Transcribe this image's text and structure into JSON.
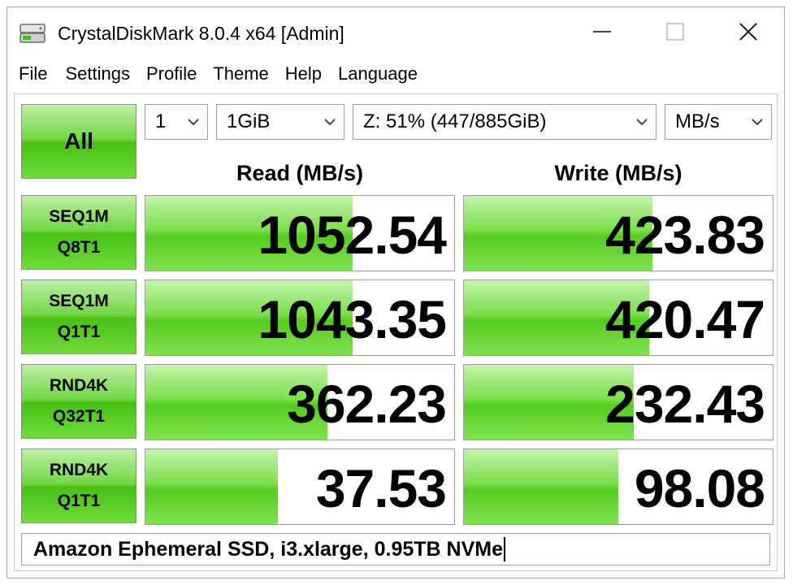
{
  "window": {
    "title": "CrystalDiskMark 8.0.4 x64 [Admin]"
  },
  "menu": [
    "File",
    "Settings",
    "Profile",
    "Theme",
    "Help",
    "Language"
  ],
  "controls": {
    "all_label": "All",
    "count": "1",
    "size": "1GiB",
    "drive": "Z: 51% (447/885GiB)",
    "unit": "MB/s"
  },
  "headers": {
    "read": "Read (MB/s)",
    "write": "Write (MB/s)"
  },
  "tests": [
    {
      "line1": "SEQ1M",
      "line2": "Q8T1",
      "read": "1052.54",
      "write": "423.83",
      "read_fill": 0.67,
      "write_fill": 0.61
    },
    {
      "line1": "SEQ1M",
      "line2": "Q1T1",
      "read": "1043.35",
      "write": "420.47",
      "read_fill": 0.67,
      "write_fill": 0.6
    },
    {
      "line1": "RND4K",
      "line2": "Q32T1",
      "read": "362.23",
      "write": "232.43",
      "read_fill": 0.59,
      "write_fill": 0.55
    },
    {
      "line1": "RND4K",
      "line2": "Q1T1",
      "read": "37.53",
      "write": "98.08",
      "read_fill": 0.43,
      "write_fill": 0.5
    }
  ],
  "comment": "Amazon Ephemeral SSD, i3.xlarge, 0.95TB NVMe",
  "colors": {
    "accent_green": "#54cc1f",
    "border": "#9c9c9c"
  }
}
